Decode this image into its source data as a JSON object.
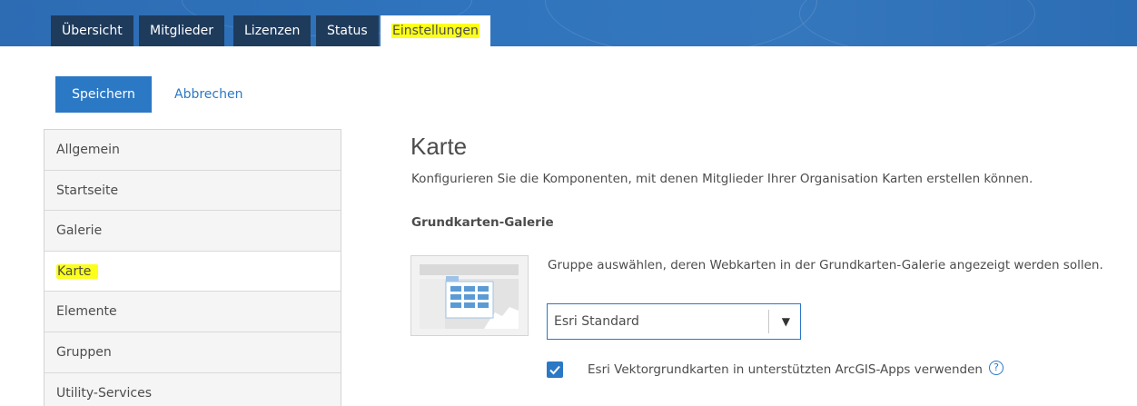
{
  "tabs": [
    {
      "label": "Übersicht"
    },
    {
      "label": "Mitglieder"
    },
    {
      "label": "Lizenzen"
    },
    {
      "label": "Status"
    },
    {
      "label": "Einstellungen",
      "active": true
    }
  ],
  "actions": {
    "save_label": "Speichern",
    "cancel_label": "Abbrechen"
  },
  "sidebar": {
    "items": [
      {
        "label": "Allgemein"
      },
      {
        "label": "Startseite"
      },
      {
        "label": "Galerie"
      },
      {
        "label": "Karte",
        "active": true
      },
      {
        "label": "Elemente"
      },
      {
        "label": "Gruppen"
      },
      {
        "label": "Utility-Services"
      }
    ]
  },
  "main": {
    "title": "Karte",
    "description": "Konfigurieren Sie die Komponenten, mit denen Mitglieder Ihrer Organisation Karten erstellen können.",
    "basemap_gallery": {
      "label": "Grundkarten-Galerie",
      "instruction": "Gruppe auswählen, deren Webkarten in der Grundkarten-Galerie angezeigt werden sollen.",
      "selected_group": "Esri Standard",
      "vector_checkbox_label": "Esri Vektorgrundkarten in unterstützten ArcGIS-Apps verwenden",
      "vector_checkbox_checked": true
    }
  },
  "colors": {
    "accent": "#2b78c5",
    "tab_bg": "#1f3b5c",
    "highlight": "#fbff1a"
  },
  "icons": {
    "select_arrow": "▼",
    "help": "?"
  }
}
